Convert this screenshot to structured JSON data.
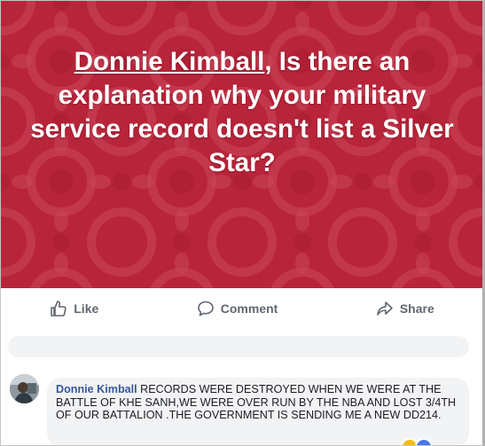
{
  "post": {
    "tagged_name": "Donnie Kimball",
    "question": ", Is there an explanation why your military service record doesn't list a Silver Star?",
    "background_color": "#b8243a"
  },
  "actions": {
    "like": "Like",
    "comment": "Comment",
    "share": "Share"
  },
  "comment": {
    "author": "Donnie Kimball",
    "text": " RECORDS WERE DESTROYED WHEN WE WERE AT THE BATTLE OF KHE SANH,WE WERE OVER RUN BY THE NBA AND LOST 3/4TH OF OUR BATTALION .THE GOVERNMENT IS SENDING ME A NEW DD214."
  },
  "icons": {
    "like": "thumbs-up-icon",
    "comment": "speech-bubble-icon",
    "share": "share-arrow-icon"
  }
}
